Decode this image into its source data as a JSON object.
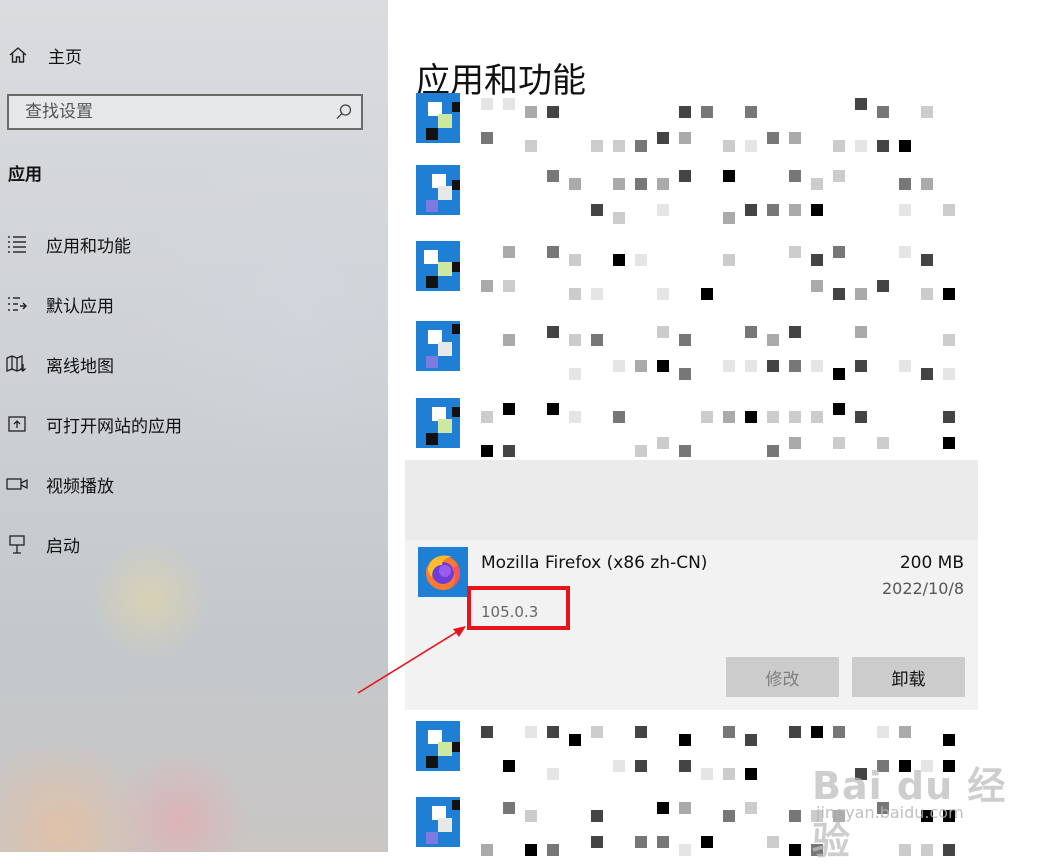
{
  "sidebar": {
    "home_label": "主页",
    "search_placeholder": "查找设置",
    "section_title": "应用",
    "items": [
      {
        "label": "应用和功能",
        "icon": "apps-features-icon"
      },
      {
        "label": "默认应用",
        "icon": "default-apps-icon"
      },
      {
        "label": "离线地图",
        "icon": "offline-maps-icon"
      },
      {
        "label": "可打开网站的应用",
        "icon": "apps-for-websites-icon"
      },
      {
        "label": "视频播放",
        "icon": "video-playback-icon"
      },
      {
        "label": "启动",
        "icon": "startup-icon"
      }
    ]
  },
  "main": {
    "title": "应用和功能",
    "selected_app": {
      "name": "Mozilla Firefox (x86 zh-CN)",
      "size": "200 MB",
      "date": "2022/10/8",
      "version": "105.0.3",
      "modify_label": "修改",
      "uninstall_label": "卸载"
    }
  },
  "watermark": {
    "logo": "Bai du 经验",
    "url": "jingyan.baidu.com"
  },
  "colors": {
    "highlight": "#e8141c",
    "icon_blue": "#1e7fd4",
    "selected_bg": "#f2f2f2"
  }
}
